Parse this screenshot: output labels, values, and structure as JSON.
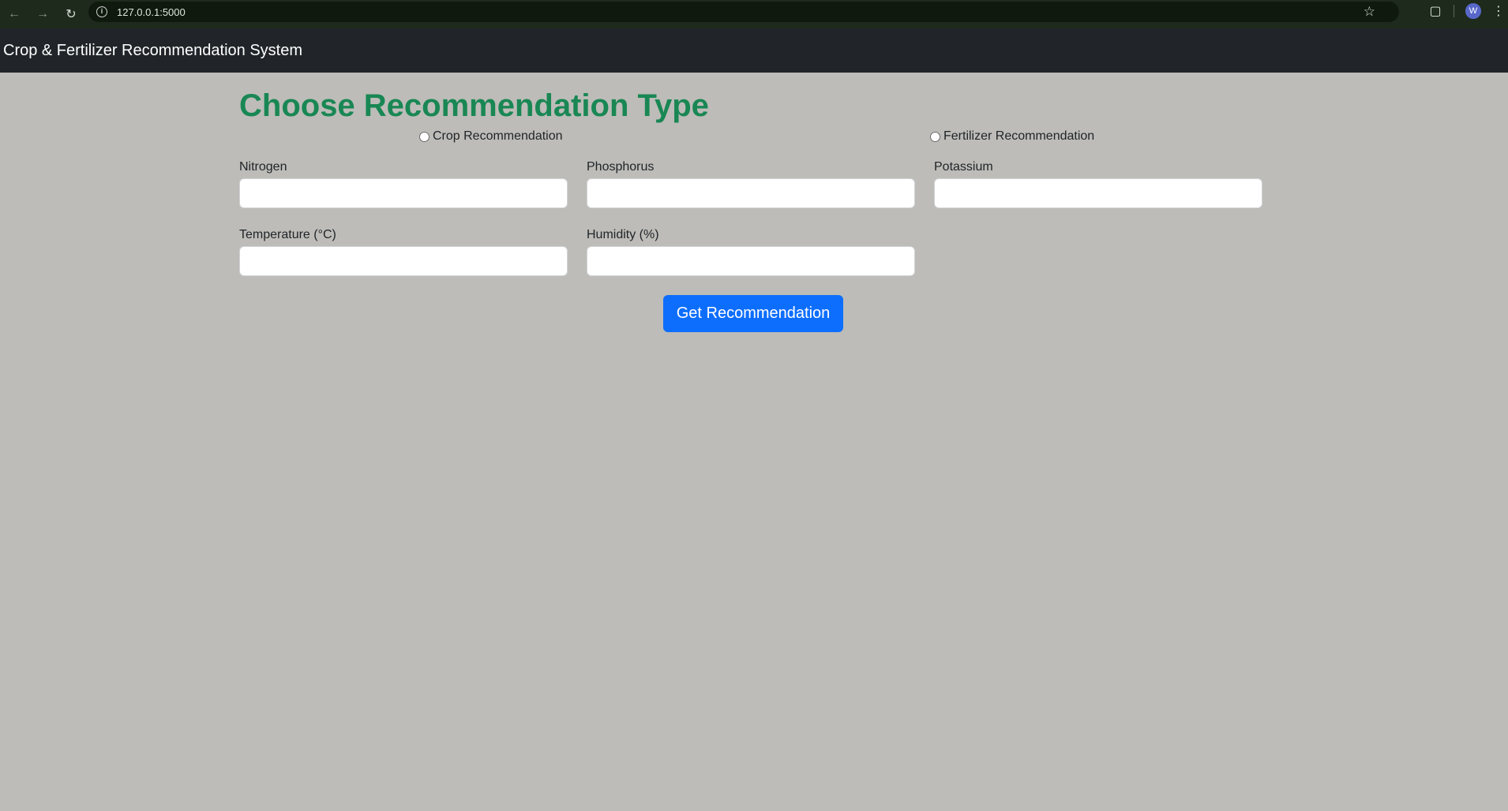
{
  "browser": {
    "url": "127.0.0.1:5000",
    "avatar_letter": "W",
    "icons": [
      "back-icon",
      "forward-icon",
      "reload-icon",
      "info-icon",
      "star-icon",
      "extensions-icon",
      "menu-icon"
    ]
  },
  "navbar": {
    "brand": "Crop & Fertilizer Recommendation System"
  },
  "main": {
    "title": "Choose Recommendation Type",
    "radios": [
      {
        "label": "Crop Recommendation",
        "checked": false
      },
      {
        "label": "Fertilizer Recommendation",
        "checked": false
      }
    ],
    "fields": [
      {
        "label": "Nitrogen",
        "value": ""
      },
      {
        "label": "Phosphorus",
        "value": ""
      },
      {
        "label": "Potassium",
        "value": ""
      },
      {
        "label": "Temperature (°C)",
        "value": ""
      },
      {
        "label": "Humidity (%)",
        "value": ""
      }
    ],
    "submit_label": "Get Recommendation"
  },
  "colors": {
    "page_bg": "#bdbcb8",
    "navbar_bg": "#212529",
    "title_green": "#198754",
    "button_blue": "#0d6efd",
    "browser_bar": "#1e2b1c"
  }
}
